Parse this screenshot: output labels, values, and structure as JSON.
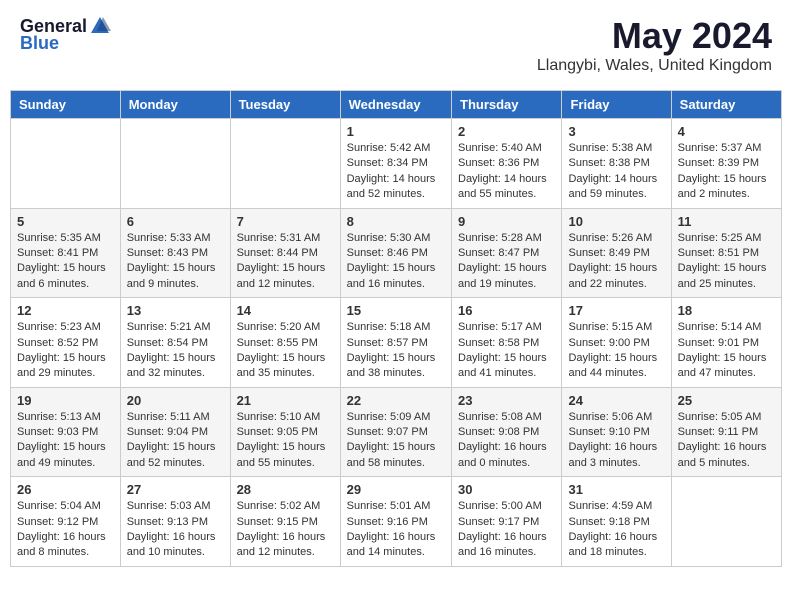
{
  "header": {
    "logo_general": "General",
    "logo_blue": "Blue",
    "title": "May 2024",
    "location": "Llangybi, Wales, United Kingdom"
  },
  "weekdays": [
    "Sunday",
    "Monday",
    "Tuesday",
    "Wednesday",
    "Thursday",
    "Friday",
    "Saturday"
  ],
  "weeks": [
    [
      {
        "day": "",
        "info": ""
      },
      {
        "day": "",
        "info": ""
      },
      {
        "day": "",
        "info": ""
      },
      {
        "day": "1",
        "info": "Sunrise: 5:42 AM\nSunset: 8:34 PM\nDaylight: 14 hours and 52 minutes."
      },
      {
        "day": "2",
        "info": "Sunrise: 5:40 AM\nSunset: 8:36 PM\nDaylight: 14 hours and 55 minutes."
      },
      {
        "day": "3",
        "info": "Sunrise: 5:38 AM\nSunset: 8:38 PM\nDaylight: 14 hours and 59 minutes."
      },
      {
        "day": "4",
        "info": "Sunrise: 5:37 AM\nSunset: 8:39 PM\nDaylight: 15 hours and 2 minutes."
      }
    ],
    [
      {
        "day": "5",
        "info": "Sunrise: 5:35 AM\nSunset: 8:41 PM\nDaylight: 15 hours and 6 minutes."
      },
      {
        "day": "6",
        "info": "Sunrise: 5:33 AM\nSunset: 8:43 PM\nDaylight: 15 hours and 9 minutes."
      },
      {
        "day": "7",
        "info": "Sunrise: 5:31 AM\nSunset: 8:44 PM\nDaylight: 15 hours and 12 minutes."
      },
      {
        "day": "8",
        "info": "Sunrise: 5:30 AM\nSunset: 8:46 PM\nDaylight: 15 hours and 16 minutes."
      },
      {
        "day": "9",
        "info": "Sunrise: 5:28 AM\nSunset: 8:47 PM\nDaylight: 15 hours and 19 minutes."
      },
      {
        "day": "10",
        "info": "Sunrise: 5:26 AM\nSunset: 8:49 PM\nDaylight: 15 hours and 22 minutes."
      },
      {
        "day": "11",
        "info": "Sunrise: 5:25 AM\nSunset: 8:51 PM\nDaylight: 15 hours and 25 minutes."
      }
    ],
    [
      {
        "day": "12",
        "info": "Sunrise: 5:23 AM\nSunset: 8:52 PM\nDaylight: 15 hours and 29 minutes."
      },
      {
        "day": "13",
        "info": "Sunrise: 5:21 AM\nSunset: 8:54 PM\nDaylight: 15 hours and 32 minutes."
      },
      {
        "day": "14",
        "info": "Sunrise: 5:20 AM\nSunset: 8:55 PM\nDaylight: 15 hours and 35 minutes."
      },
      {
        "day": "15",
        "info": "Sunrise: 5:18 AM\nSunset: 8:57 PM\nDaylight: 15 hours and 38 minutes."
      },
      {
        "day": "16",
        "info": "Sunrise: 5:17 AM\nSunset: 8:58 PM\nDaylight: 15 hours and 41 minutes."
      },
      {
        "day": "17",
        "info": "Sunrise: 5:15 AM\nSunset: 9:00 PM\nDaylight: 15 hours and 44 minutes."
      },
      {
        "day": "18",
        "info": "Sunrise: 5:14 AM\nSunset: 9:01 PM\nDaylight: 15 hours and 47 minutes."
      }
    ],
    [
      {
        "day": "19",
        "info": "Sunrise: 5:13 AM\nSunset: 9:03 PM\nDaylight: 15 hours and 49 minutes."
      },
      {
        "day": "20",
        "info": "Sunrise: 5:11 AM\nSunset: 9:04 PM\nDaylight: 15 hours and 52 minutes."
      },
      {
        "day": "21",
        "info": "Sunrise: 5:10 AM\nSunset: 9:05 PM\nDaylight: 15 hours and 55 minutes."
      },
      {
        "day": "22",
        "info": "Sunrise: 5:09 AM\nSunset: 9:07 PM\nDaylight: 15 hours and 58 minutes."
      },
      {
        "day": "23",
        "info": "Sunrise: 5:08 AM\nSunset: 9:08 PM\nDaylight: 16 hours and 0 minutes."
      },
      {
        "day": "24",
        "info": "Sunrise: 5:06 AM\nSunset: 9:10 PM\nDaylight: 16 hours and 3 minutes."
      },
      {
        "day": "25",
        "info": "Sunrise: 5:05 AM\nSunset: 9:11 PM\nDaylight: 16 hours and 5 minutes."
      }
    ],
    [
      {
        "day": "26",
        "info": "Sunrise: 5:04 AM\nSunset: 9:12 PM\nDaylight: 16 hours and 8 minutes."
      },
      {
        "day": "27",
        "info": "Sunrise: 5:03 AM\nSunset: 9:13 PM\nDaylight: 16 hours and 10 minutes."
      },
      {
        "day": "28",
        "info": "Sunrise: 5:02 AM\nSunset: 9:15 PM\nDaylight: 16 hours and 12 minutes."
      },
      {
        "day": "29",
        "info": "Sunrise: 5:01 AM\nSunset: 9:16 PM\nDaylight: 16 hours and 14 minutes."
      },
      {
        "day": "30",
        "info": "Sunrise: 5:00 AM\nSunset: 9:17 PM\nDaylight: 16 hours and 16 minutes."
      },
      {
        "day": "31",
        "info": "Sunrise: 4:59 AM\nSunset: 9:18 PM\nDaylight: 16 hours and 18 minutes."
      },
      {
        "day": "",
        "info": ""
      }
    ]
  ]
}
